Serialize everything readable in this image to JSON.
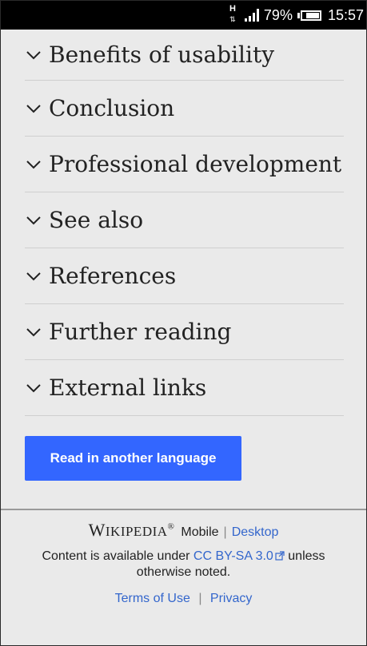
{
  "status_bar": {
    "network": "H",
    "battery": "79%",
    "battery_level": 0.79,
    "time": "15:57"
  },
  "sections": [
    {
      "label": "Benefits of usability"
    },
    {
      "label": "Conclusion"
    },
    {
      "label": "Professional development"
    },
    {
      "label": "See also"
    },
    {
      "label": "References"
    },
    {
      "label": "Further reading"
    },
    {
      "label": "External links"
    }
  ],
  "language_button": "Read in another language",
  "footer": {
    "wordmark": "Wikipedia",
    "mode_current": "Mobile",
    "mode_other": "Desktop",
    "license_prefix": "Content is available under",
    "license_link": "CC BY-SA 3.0",
    "license_suffix": "unless otherwise noted.",
    "terms": "Terms of Use",
    "privacy": "Privacy"
  },
  "colors": {
    "accent": "#3366ff",
    "link": "#3366cc",
    "background": "#eaeaea"
  }
}
